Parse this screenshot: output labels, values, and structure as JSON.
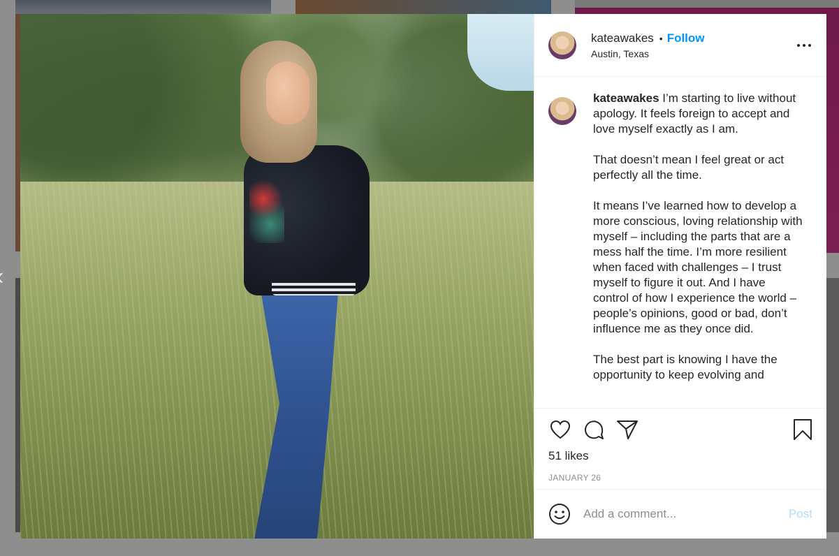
{
  "post": {
    "username": "kateawakes",
    "follow_label": "Follow",
    "separator": "•",
    "location": "Austin, Texas",
    "caption_paragraphs": [
      "I’m starting to live without apology. It feels foreign to accept and love myself exactly as I am.",
      "That doesn’t mean I feel great or act perfectly all the time.",
      "It means I’ve learned how to develop a more conscious, loving relationship with myself – including the parts that are a mess half the time. I’m more resilient when faced with challenges – I trust myself to figure it out. And I have control of how I experience the world – people’s opinions, good or bad, don’t influence me as they once did.",
      "The best part is knowing I have the opportunity to keep evolving and"
    ],
    "likes": "51 likes",
    "date": "JANUARY 26"
  },
  "comment_bar": {
    "placeholder": "Add a comment...",
    "post_label": "Post"
  },
  "nav": {
    "prev_arrow": "‹"
  },
  "icons": {
    "like": "heart-icon",
    "comment": "comment-icon",
    "share": "paper-plane-icon",
    "save": "bookmark-icon",
    "emoji": "smiley-icon",
    "more": "more-options-icon"
  },
  "colors": {
    "follow": "#0095f6",
    "post_disabled": "#b3dbff",
    "text": "#262626",
    "muted": "#8e8e8e"
  }
}
